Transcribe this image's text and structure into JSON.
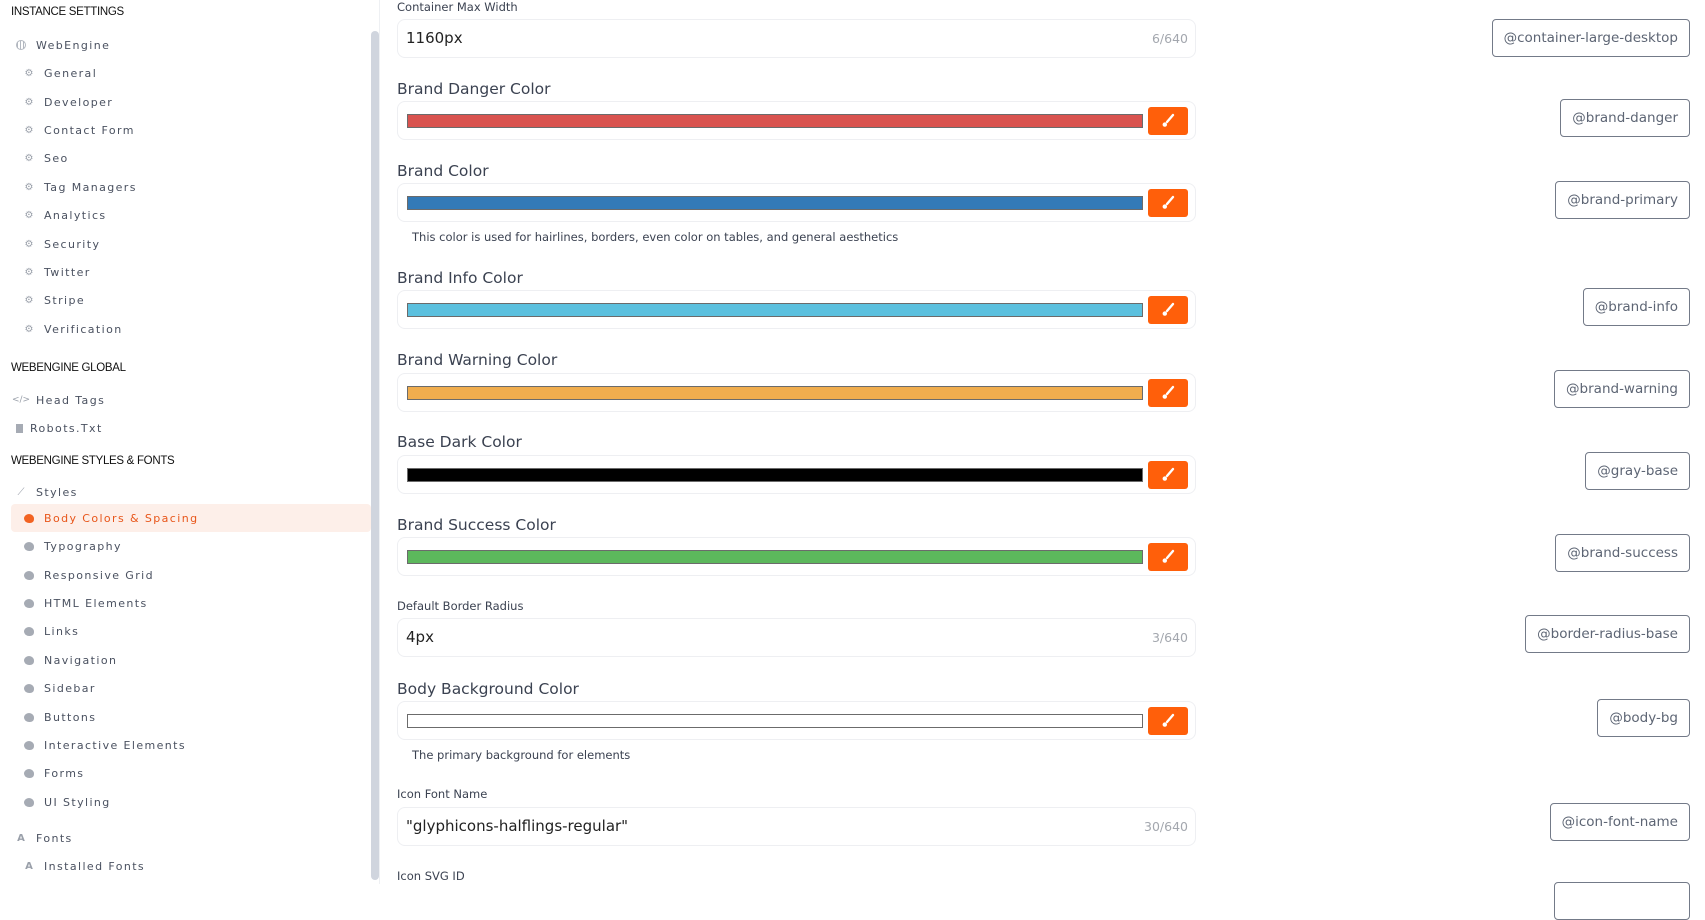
{
  "sidebar": {
    "sections": [
      {
        "title": "INSTANCE SETTINGS"
      },
      {
        "title": "WEBENGINE GLOBAL"
      },
      {
        "title": "WEBENGINE STYLES & FONTS"
      }
    ],
    "instance_items": [
      {
        "label": "WebEngine",
        "icon": "globe-icon",
        "level": 1
      },
      {
        "label": "General",
        "icon": "gear-icon",
        "level": 2
      },
      {
        "label": "Developer",
        "icon": "gear-icon",
        "level": 2
      },
      {
        "label": "Contact Form",
        "icon": "gear-icon",
        "level": 2
      },
      {
        "label": "Seo",
        "icon": "gear-icon",
        "level": 2
      },
      {
        "label": "Tag Managers",
        "icon": "gear-icon",
        "level": 2
      },
      {
        "label": "Analytics",
        "icon": "gear-icon",
        "level": 2
      },
      {
        "label": "Security",
        "icon": "gear-icon",
        "level": 2
      },
      {
        "label": "Twitter",
        "icon": "gear-icon",
        "level": 2
      },
      {
        "label": "Stripe",
        "icon": "gear-icon",
        "level": 2
      },
      {
        "label": "Verification",
        "icon": "gear-icon",
        "level": 2
      }
    ],
    "global_items": [
      {
        "label": "Head Tags",
        "icon": "code-icon",
        "level": 1
      },
      {
        "label": "Robots.Txt",
        "icon": "file-icon",
        "level": 1
      }
    ],
    "styles_items": [
      {
        "label": "Styles",
        "icon": "brush-icon",
        "level": 1
      },
      {
        "label": "Body Colors & Spacing",
        "icon": "palette-icon",
        "level": 2,
        "active": true
      },
      {
        "label": "Typography",
        "icon": "palette-icon",
        "level": 2
      },
      {
        "label": "Responsive Grid",
        "icon": "palette-icon",
        "level": 2
      },
      {
        "label": "HTML Elements",
        "icon": "palette-icon",
        "level": 2
      },
      {
        "label": "Links",
        "icon": "palette-icon",
        "level": 2
      },
      {
        "label": "Navigation",
        "icon": "palette-icon",
        "level": 2
      },
      {
        "label": "Sidebar",
        "icon": "palette-icon",
        "level": 2
      },
      {
        "label": "Buttons",
        "icon": "palette-icon",
        "level": 2
      },
      {
        "label": "Interactive Elements",
        "icon": "palette-icon",
        "level": 2
      },
      {
        "label": "Forms",
        "icon": "palette-icon",
        "level": 2
      },
      {
        "label": "UI Styling",
        "icon": "palette-icon",
        "level": 2
      },
      {
        "label": "Fonts",
        "icon": "font-icon",
        "level": 1
      },
      {
        "label": "Installed Fonts",
        "icon": "font-icon",
        "level": 2
      }
    ]
  },
  "fields": [
    {
      "label": "Container Max Width",
      "type": "text",
      "value": "1160px",
      "counter": "6/640",
      "variable": "@container-large-desktop"
    },
    {
      "label": "Brand Danger Color",
      "type": "color",
      "color": "#d9534f",
      "variable": "@brand-danger"
    },
    {
      "label": "Brand Color",
      "type": "color",
      "color": "#337ab7",
      "help": "This color is used for hairlines, borders, even color on tables, and general aesthetics",
      "variable": "@brand-primary"
    },
    {
      "label": "Brand Info Color",
      "type": "color",
      "color": "#5bc0de",
      "variable": "@brand-info"
    },
    {
      "label": "Brand Warning Color",
      "type": "color",
      "color": "#f0ad4e",
      "variable": "@brand-warning"
    },
    {
      "label": "Base Dark Color",
      "type": "color",
      "color": "#000000",
      "variable": "@gray-base"
    },
    {
      "label": "Brand Success Color",
      "type": "color",
      "color": "#5cb85c",
      "variable": "@brand-success"
    },
    {
      "label": "Default Border Radius",
      "type": "text",
      "value": "4px",
      "counter": "3/640",
      "variable": "@border-radius-base"
    },
    {
      "label": "Body Background Color",
      "type": "color",
      "color": "#ffffff",
      "help": "The primary background for elements",
      "variable": "@body-bg"
    },
    {
      "label": "Icon Font Name",
      "type": "text",
      "value": "\"glyphicons-halflings-regular\"",
      "counter": "30/640",
      "variable": "@icon-font-name"
    },
    {
      "label": "Icon SVG ID",
      "type": "text"
    }
  ],
  "colors": {
    "accent": "#ff5f0a",
    "active_bg": "#fdefe9",
    "active_text": "#e8561a"
  }
}
